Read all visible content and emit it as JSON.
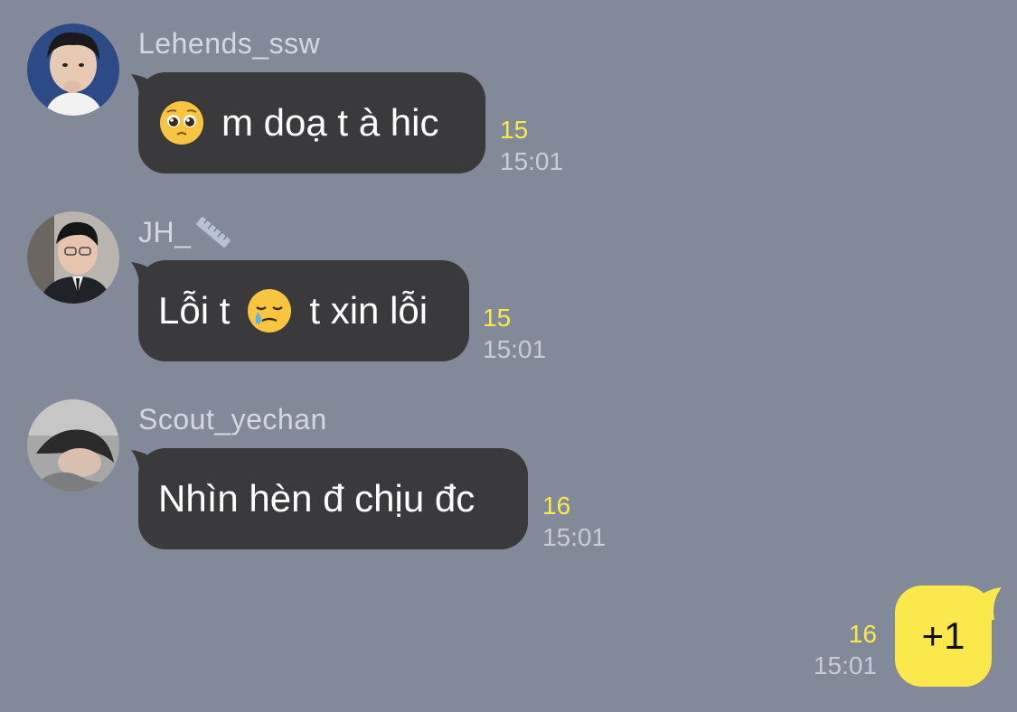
{
  "colors": {
    "background": "#828a9a",
    "bubble_other": "#3a3a3d",
    "bubble_mine": "#fbe84a",
    "unread_count": "#fbe84a",
    "timestamp": "#c9ccd4"
  },
  "messages": [
    {
      "sender": "Lehends_ssw",
      "text_before_emoji": "",
      "emoji": "pleading-face-icon",
      "text_after_emoji": "m doạ t à hic",
      "unread": "15",
      "time": "15:01"
    },
    {
      "sender": "JH_",
      "sender_icon": "ruler-icon",
      "text_before_emoji": "Lỗi t",
      "emoji": "face-holding-back-tears-icon",
      "text_after_emoji": "t xin lỗi",
      "unread": "15",
      "time": "15:01"
    },
    {
      "sender": "Scout_yechan",
      "text": "Nhìn hèn đ chịu đc",
      "unread": "16",
      "time": "15:01"
    }
  ],
  "my_message": {
    "text": "+1",
    "unread": "16",
    "time": "15:01"
  }
}
